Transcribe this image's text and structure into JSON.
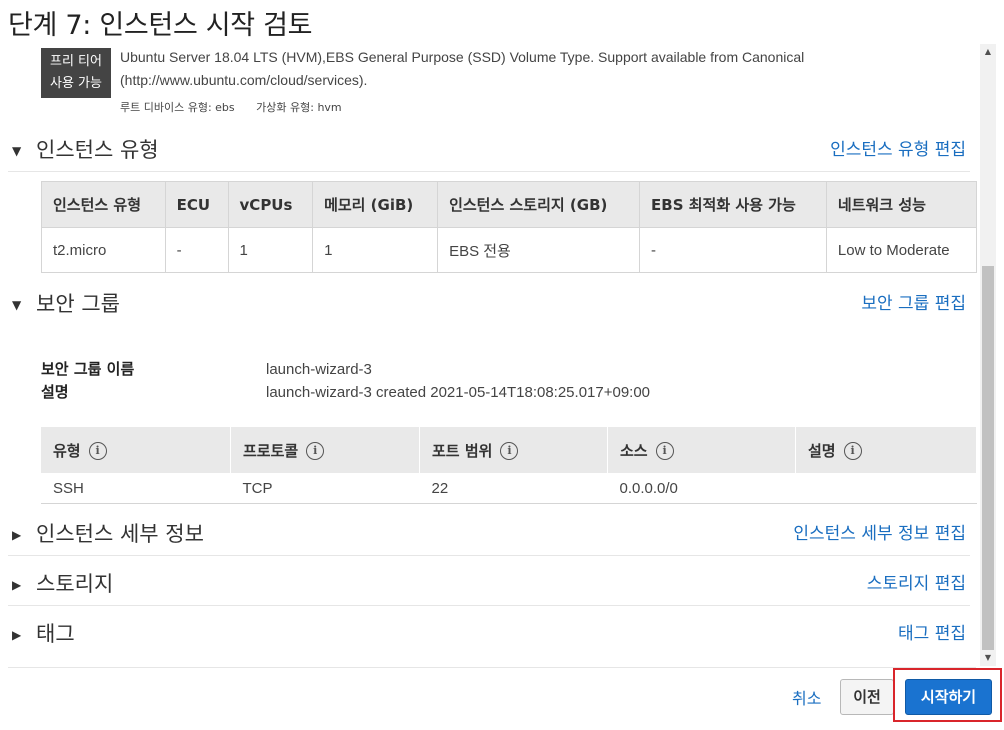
{
  "page": {
    "title": "단계 7: 인스턴스 시작 검토"
  },
  "ami": {
    "badge_line1": "프리 티어",
    "badge_line2": "사용 가능",
    "desc_line1": "Ubuntu Server 18.04 LTS (HVM),EBS General Purpose (SSD) Volume Type. Support available from Canonical",
    "desc_line2": "(http://www.ubuntu.com/cloud/services).",
    "root_device": "루트 디바이스 유형: ebs",
    "virt_type": "가상화 유형: hvm"
  },
  "instance_type": {
    "title": "인스턴스 유형",
    "edit": "인스턴스 유형 편집",
    "columns": [
      "인스턴스 유형",
      "ECU",
      "vCPUs",
      "메모리 (GiB)",
      "인스턴스 스토리지 (GB)",
      "EBS 최적화 사용 가능",
      "네트워크 성능"
    ],
    "row": [
      "t2.micro",
      "-",
      "1",
      "1",
      "EBS 전용",
      "-",
      "Low to Moderate"
    ]
  },
  "security_group": {
    "title": "보안 그룹",
    "edit": "보안 그룹 편집",
    "name_label": "보안 그룹 이름",
    "name_value": "launch-wizard-3",
    "desc_label": "설명",
    "desc_value": "launch-wizard-3 created 2021-05-14T18:08:25.017+09:00",
    "columns": [
      "유형",
      "프로토콜",
      "포트 범위",
      "소스",
      "설명"
    ],
    "row": [
      "SSH",
      "TCP",
      "22",
      "0.0.0.0/0",
      ""
    ]
  },
  "instance_details": {
    "title": "인스턴스 세부 정보",
    "edit": "인스턴스 세부 정보 편집"
  },
  "storage": {
    "title": "스토리지",
    "edit": "스토리지 편집"
  },
  "tags": {
    "title": "태그",
    "edit": "태그 편집"
  },
  "icons": {
    "expanded": "▼",
    "collapsed": "▶",
    "info": "i"
  },
  "footer": {
    "cancel": "취소",
    "previous": "이전",
    "launch": "시작하기"
  },
  "colors": {
    "link": "#1a6ec0",
    "primary": "#1a73d0",
    "highlight": "#d9252b"
  }
}
